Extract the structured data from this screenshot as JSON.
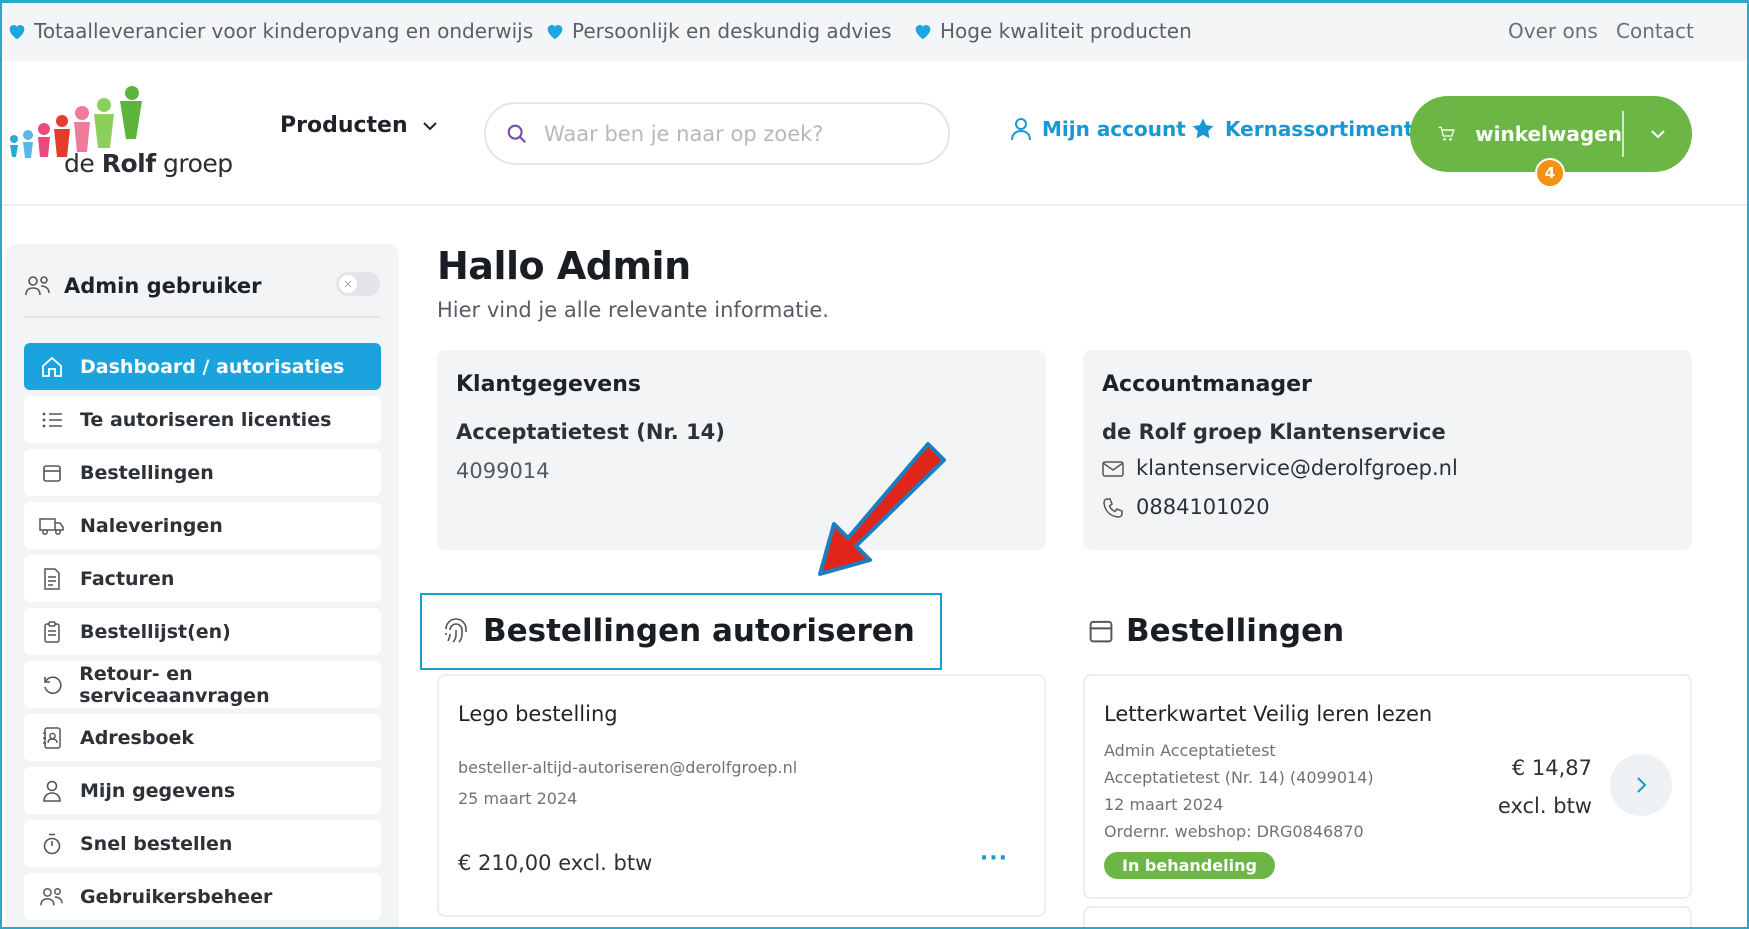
{
  "topbar": {
    "usps": [
      "Totaalleverancier voor kinderopvang en onderwijs",
      "Persoonlijk en deskundig advies",
      "Hoge kwaliteit producten"
    ],
    "links": [
      "Over ons",
      "Contact"
    ]
  },
  "header": {
    "logo_text_regular": "de ",
    "logo_text_bold": "Rolf",
    "logo_text_tail": " groep",
    "products_label": "Producten",
    "search_placeholder": "Waar ben je naar op zoek?",
    "account_label": "Mijn account",
    "core_label": "Kernassortiment",
    "cart_label": "winkelwagen",
    "cart_count": "4"
  },
  "sidebar": {
    "admin_label": "Admin gebruiker",
    "items": [
      {
        "label": "Dashboard / autorisaties",
        "icon": "home-icon",
        "active": true
      },
      {
        "label": "Te autoriseren licenties",
        "icon": "list-icon"
      },
      {
        "label": "Bestellingen",
        "icon": "box-icon"
      },
      {
        "label": "Naleveringen",
        "icon": "truck-icon"
      },
      {
        "label": "Facturen",
        "icon": "invoice-icon"
      },
      {
        "label": "Bestellijst(en)",
        "icon": "clipboard-icon"
      },
      {
        "label": "Retour- en serviceaanvragen",
        "icon": "return-icon"
      },
      {
        "label": "Adresboek",
        "icon": "addressbook-icon"
      },
      {
        "label": "Mijn gegevens",
        "icon": "user-icon"
      },
      {
        "label": "Snel bestellen",
        "icon": "stopwatch-icon"
      },
      {
        "label": "Gebruikersbeheer",
        "icon": "users-icon"
      }
    ]
  },
  "main": {
    "greeting": "Hallo Admin",
    "subtitle": "Hier vind je alle relevante informatie.",
    "customer": {
      "title": "Klantgegevens",
      "name": "Acceptatietest (Nr. 14)",
      "number": "4099014"
    },
    "manager": {
      "title": "Accountmanager",
      "name": "de Rolf groep Klantenservice",
      "email": "klantenservice@derolfgroep.nl",
      "phone": "0884101020"
    },
    "authorize": {
      "title": "Bestellingen autoriseren",
      "order_title": "Lego bestelling",
      "order_email": "besteller-altijd-autoriseren@derolfgroep.nl",
      "order_date": "25 maart 2024",
      "order_price": "€ 210,00 excl. btw",
      "more": "···"
    },
    "orders": {
      "title": "Bestellingen",
      "order_title": "Letterkwartet Veilig leren lezen",
      "line1": "Admin Acceptatietest",
      "line2": "Acceptatietest (Nr. 14) (4099014)",
      "line3": "12 maart 2024",
      "line4": "Ordernr. webshop: DRG0846870",
      "status": "In behandeling",
      "price": "€ 14,87",
      "price_suffix": "excl. btw"
    }
  },
  "colors": {
    "brand_blue": "#1aa3dc",
    "cart_green": "#6bb644",
    "badge_orange": "#f39214",
    "annotation_red": "#e0261b"
  }
}
